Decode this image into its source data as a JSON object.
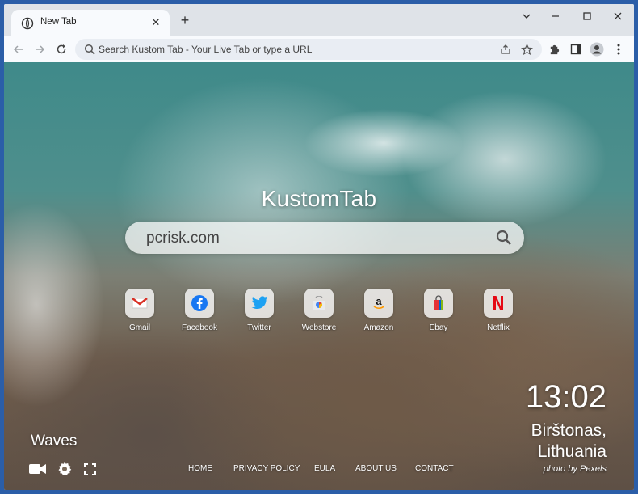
{
  "tab": {
    "title": "New Tab",
    "icon": "kustomtab-favicon"
  },
  "omnibox": {
    "placeholder": "Search Kustom Tab - Your Live Tab or type a URL"
  },
  "page": {
    "brand": "KustomTab",
    "search_value": "pcrisk.com",
    "shortcuts": [
      {
        "label": "Gmail",
        "icon": "gmail-icon",
        "color": "#d93025"
      },
      {
        "label": "Facebook",
        "icon": "facebook-icon",
        "color": "#1877f2"
      },
      {
        "label": "Twitter",
        "icon": "twitter-icon",
        "color": "#1da1f2"
      },
      {
        "label": "Webstore",
        "icon": "webstore-icon",
        "color": "#4285f4"
      },
      {
        "label": "Amazon",
        "icon": "amazon-icon",
        "color": "#ff9900"
      },
      {
        "label": "Ebay",
        "icon": "ebay-icon",
        "color": "#86b817"
      },
      {
        "label": "Netflix",
        "icon": "netflix-icon",
        "color": "#e50914"
      }
    ],
    "clock": "13:02",
    "city": "Birštonas,",
    "country": "Lithuania",
    "photo_credit": "photo by Pexels",
    "theme_name": "Waves",
    "footer_links": [
      "HOME",
      "PRIVACY POLICY",
      "EULA",
      "ABOUT US",
      "CONTACT"
    ]
  },
  "colors": {
    "window_frame": "#2b5ea8",
    "titlebar": "#dfe3e8",
    "toolbar": "#f8fafd",
    "omnibox": "#e9edf3"
  }
}
